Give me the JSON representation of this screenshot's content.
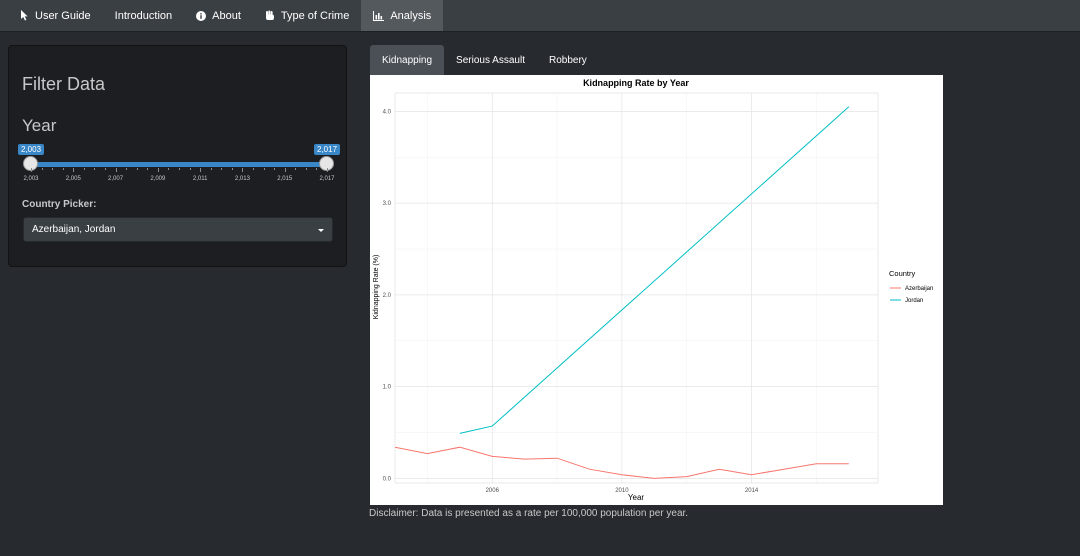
{
  "nav": {
    "items": [
      {
        "label": "User Guide",
        "icon": "cursor-icon"
      },
      {
        "label": "Introduction",
        "icon": ""
      },
      {
        "label": "About",
        "icon": "info-circle-icon"
      },
      {
        "label": "Type of Crime",
        "icon": "fist-icon"
      },
      {
        "label": "Analysis",
        "icon": "bar-chart-icon"
      }
    ],
    "active_index": 4
  },
  "sidebar": {
    "title": "Filter Data",
    "year_label": "Year",
    "slider": {
      "min": 2003,
      "max": 2017,
      "from": 2003,
      "to": 2017,
      "from_badge": "2,003",
      "to_badge": "2,017",
      "tick_labels": [
        "2,003",
        "2,005",
        "2,007",
        "2,009",
        "2,011",
        "2,013",
        "2,015",
        "2,017"
      ]
    },
    "country_picker_label": "Country Picker:",
    "country_picker_value": "Azerbaijan, Jordan"
  },
  "tabs": [
    {
      "label": "Kidnapping",
      "active": true
    },
    {
      "label": "Serious Assault",
      "active": false
    },
    {
      "label": "Robbery",
      "active": false
    }
  ],
  "chart_data": {
    "type": "line",
    "title": "Kidnapping Rate by Year",
    "xlabel": "Year",
    "ylabel": "Kidnapping Rate (%)",
    "xlim": [
      2003,
      2017.9
    ],
    "ylim": [
      -0.05,
      4.2
    ],
    "xticks": [
      2006,
      2010,
      2014
    ],
    "xtick_labels": [
      "2006",
      "2010",
      "2014"
    ],
    "yticks": [
      0,
      1,
      2,
      3,
      4
    ],
    "ytick_labels": [
      "0.0",
      "1.0",
      "2.0",
      "3.0",
      "4.0"
    ],
    "grid": true,
    "legend_title": "Country",
    "legend_position": "right",
    "series": [
      {
        "name": "Azerbaijan",
        "color": "#f8766d",
        "x": [
          2003,
          2004,
          2005,
          2006,
          2007,
          2008,
          2009,
          2010,
          2011,
          2012,
          2013,
          2014,
          2015,
          2016,
          2017
        ],
        "y": [
          0.34,
          0.27,
          0.34,
          0.24,
          0.21,
          0.22,
          0.1,
          0.04,
          0.0,
          0.02,
          0.1,
          0.04,
          0.1,
          0.16,
          0.16
        ]
      },
      {
        "name": "Jordan",
        "color": "#00bfc4",
        "x": [
          2005,
          2006,
          2017
        ],
        "y": [
          0.49,
          0.57,
          4.05
        ]
      }
    ]
  },
  "disclaimer": "Disclaimer: Data is presented as a rate per 100,000 population per year."
}
